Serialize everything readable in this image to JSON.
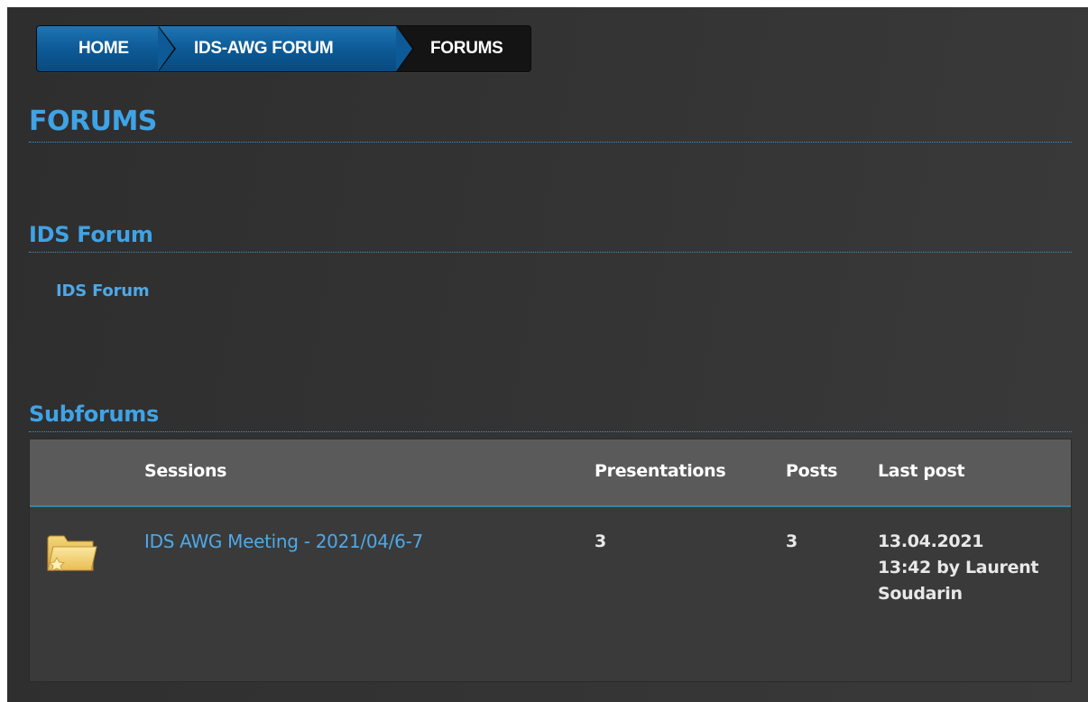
{
  "breadcrumb": {
    "home": "HOME",
    "awg_forum": "IDS-AWG FORUM",
    "forums": "FORUMS"
  },
  "page_title": "FORUMS",
  "section_ids": {
    "heading": "IDS Forum",
    "link": "IDS Forum"
  },
  "section_subforums": {
    "heading": "Subforums",
    "columns": {
      "sessions": "Sessions",
      "presentations": "Presentations",
      "posts": "Posts",
      "last_post": "Last post"
    },
    "rows": [
      {
        "icon": "folder-star-icon",
        "session": "IDS AWG Meeting - 2021/04/6-7",
        "presentations": "3",
        "posts": "3",
        "last_post": "13.04.2021 13:42 by Laurent Soudarin"
      }
    ]
  },
  "colors": {
    "accent": "#3fa3e6",
    "link": "#4ea8e8",
    "breadcrumb_blue": "#0d5a96",
    "background": "#333333"
  }
}
